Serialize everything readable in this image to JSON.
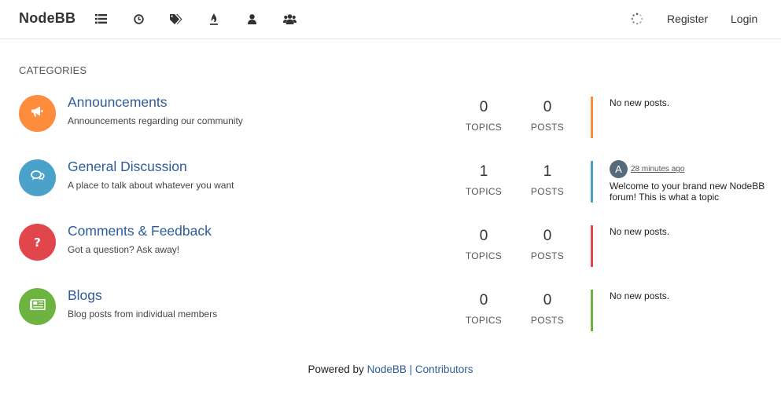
{
  "nav": {
    "brand": "NodeBB",
    "icons": [
      "categories-list-icon",
      "recent-clock-icon",
      "tags-icon",
      "popular-fire-icon",
      "users-icon",
      "groups-icon"
    ],
    "register": "Register",
    "login": "Login"
  },
  "page": {
    "section_title": "CATEGORIES"
  },
  "categories": [
    {
      "title": "Announcements",
      "description": "Announcements regarding our community",
      "color": "#fd8d3c",
      "icon": "bullhorn-icon",
      "topics": "0",
      "topics_label": "TOPICS",
      "posts": "0",
      "posts_label": "POSTS",
      "teaser": "No new posts."
    },
    {
      "title": "General Discussion",
      "description": "A place to talk about whatever you want",
      "color": "#4aa1c9",
      "icon": "comments-icon",
      "topics": "1",
      "topics_label": "TOPICS",
      "posts": "1",
      "posts_label": "POSTS",
      "teaser_avatar": "A",
      "teaser_time": "28 minutes ago",
      "teaser_text": "Welcome to your brand new NodeBB forum! This is what a topic"
    },
    {
      "title": "Comments & Feedback",
      "description": "Got a question? Ask away!",
      "color": "#e0464b",
      "icon": "question-icon",
      "topics": "0",
      "topics_label": "TOPICS",
      "posts": "0",
      "posts_label": "POSTS",
      "teaser": "No new posts."
    },
    {
      "title": "Blogs",
      "description": "Blog posts from individual members",
      "color": "#6db33f",
      "icon": "newspaper-icon",
      "topics": "0",
      "topics_label": "TOPICS",
      "posts": "0",
      "posts_label": "POSTS",
      "teaser": "No new posts."
    }
  ],
  "footer": {
    "prefix": "Powered by",
    "nodebb_link": "NodeBB",
    "separator": "|",
    "contributors_link": "Contributors"
  }
}
